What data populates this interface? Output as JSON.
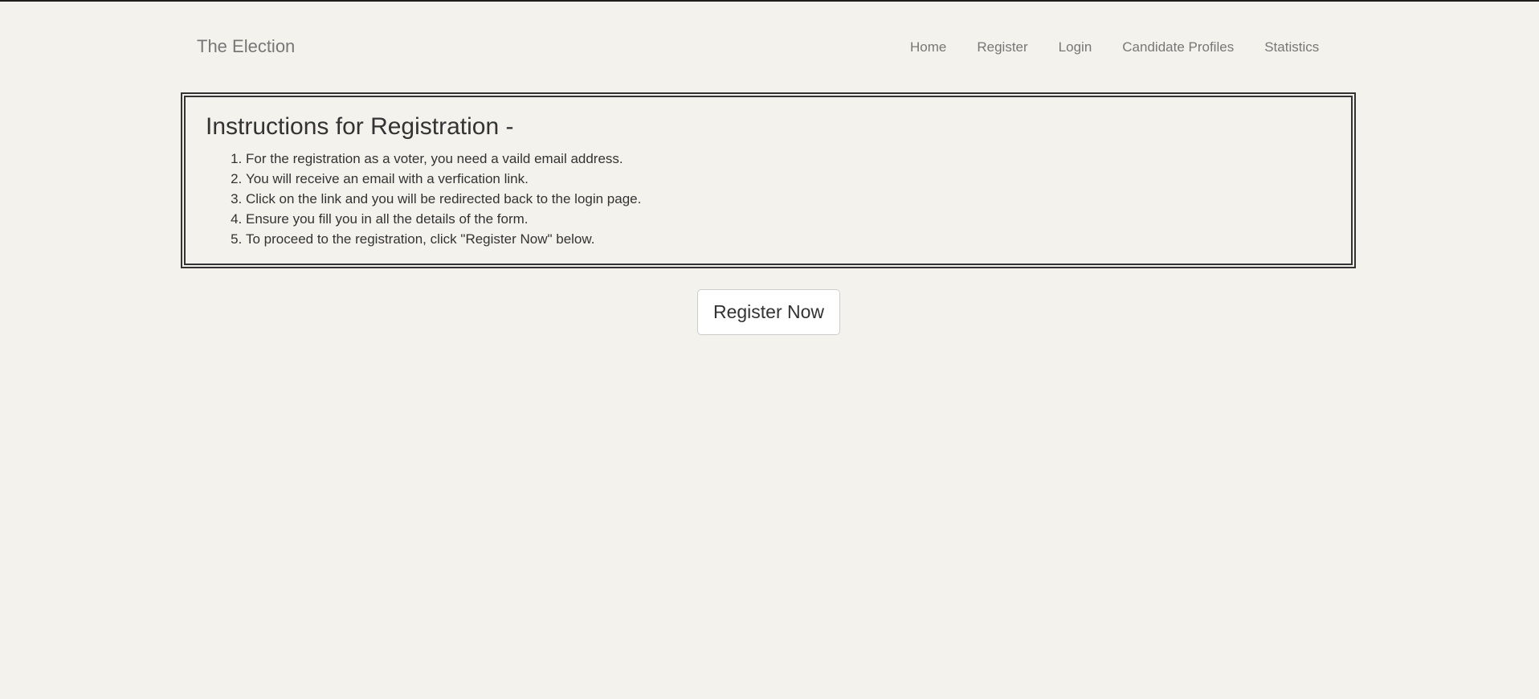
{
  "navbar": {
    "brand": "The Election",
    "links": [
      {
        "label": "Home"
      },
      {
        "label": "Register"
      },
      {
        "label": "Login"
      },
      {
        "label": "Candidate Profiles"
      },
      {
        "label": "Statistics"
      }
    ]
  },
  "instructions": {
    "title": "Instructions for Registration -",
    "steps": [
      "For the registration as a voter, you need a vaild email address.",
      "You will receive an email with a verfication link.",
      "Click on the link and you will be redirected back to the login page.",
      "Ensure you fill you in all the details of the form.",
      "To proceed to the registration, click \"Register Now\" below."
    ]
  },
  "actions": {
    "register_now": "Register Now"
  },
  "colors": {
    "background": "#f3f2ed",
    "text": "#333333",
    "nav_text": "#777777",
    "button_bg": "#ffffff",
    "button_border": "#cccccc"
  }
}
